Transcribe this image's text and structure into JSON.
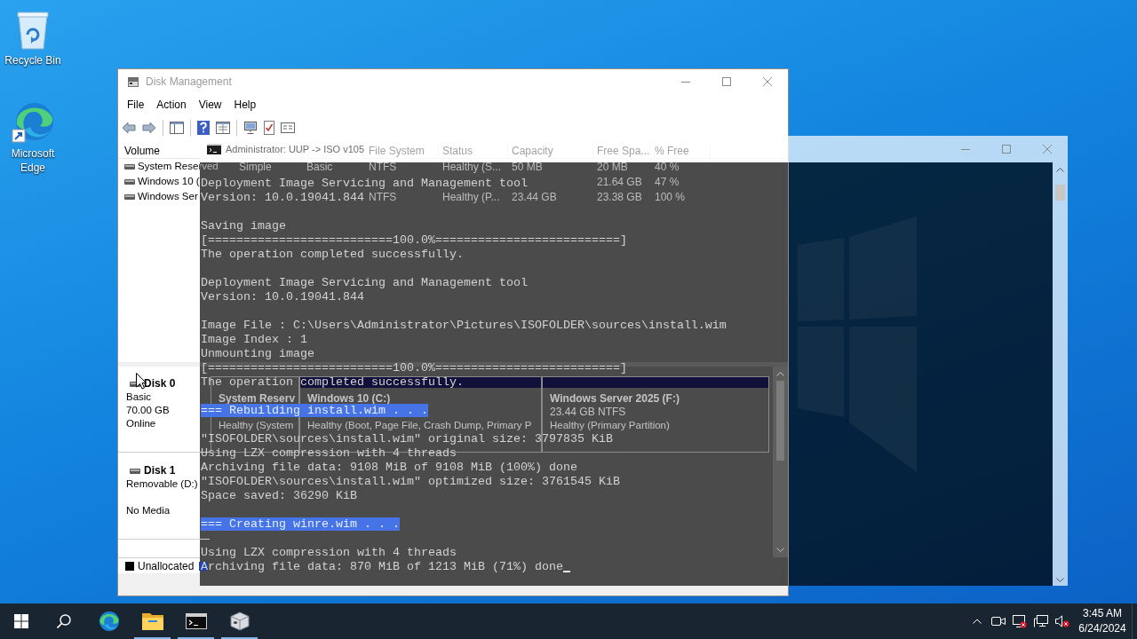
{
  "desktop": {
    "shortcuts": [
      {
        "kind": "recycle-bin",
        "label": "Recycle Bin"
      },
      {
        "kind": "edge",
        "label": "Microsoft Edge"
      }
    ]
  },
  "disk_management": {
    "window": {
      "title": "Disk Management"
    },
    "menu": [
      "File",
      "Action",
      "View",
      "Help"
    ],
    "volumes": {
      "columns": [
        "Volume",
        null,
        null,
        "File System",
        "Status",
        "Capacity",
        "Free Spa...",
        "% Free"
      ],
      "rows": [
        [
          "System Reserved",
          "Simple",
          "Basic",
          "NTFS",
          "Healthy (S...",
          "50 MB",
          "20 MB",
          "40 %"
        ],
        [
          "Windows 10 (",
          null,
          null,
          null,
          null,
          null,
          "21.64 GB",
          "47 %"
        ],
        [
          "Windows Ser",
          null,
          null,
          "NTFS",
          "Healthy (P...",
          "23.44 GB",
          "23.38 GB",
          "100 %"
        ]
      ]
    },
    "disks": [
      {
        "name": "Disk 0",
        "type": "Basic",
        "size": "70.00 GB",
        "status": "Online",
        "partitions": [
          {
            "name": "System Reserv",
            "status": "Healthy (System",
            "header_bar": false
          },
          {
            "name": "Windows 10 (C:)",
            "status": "Healthy (Boot, Page File, Crash Dump, Primary P",
            "header_bar": true
          },
          {
            "name": "Windows Server 2025 (F:)",
            "size": "23.44 GB NTFS",
            "status": "Healthy (Primary Partition)",
            "header_bar": true
          }
        ]
      },
      {
        "name": "Disk 1",
        "type": "Removable (D:)",
        "status": "No Media"
      }
    ],
    "legend": [
      {
        "label": "Unallocated",
        "color": "#000000"
      },
      {
        "color": "#2142a8"
      }
    ]
  },
  "console": {
    "title": "Administrator: UUP -> ISO v105",
    "blocks": [
      [
        {
          "text": "Deployment Image Servicing and Management tool",
          "highlighted": false
        },
        {
          "text": "Version: 10.0.19041.844",
          "highlighted": false
        }
      ],
      [
        {
          "text": "Saving image",
          "highlighted": false
        },
        {
          "text": "[==========================100.0%==========================]",
          "highlighted": false
        },
        {
          "text": "The operation completed successfully.",
          "highlighted": false
        }
      ],
      [
        {
          "text": "Deployment Image Servicing and Management tool",
          "highlighted": false
        },
        {
          "text": "Version: 10.0.19041.844",
          "highlighted": false
        }
      ],
      [
        {
          "text": "Image File : C:\\Users\\Administrator\\Pictures\\ISOFOLDER\\sources\\install.wim",
          "highlighted": false
        },
        {
          "text": "Image Index : 1",
          "highlighted": false
        },
        {
          "text": "Unmounting image",
          "highlighted": false
        },
        {
          "text": "[==========================100.0%==========================]",
          "highlighted": false
        },
        {
          "text": "The operation completed successfully.",
          "highlighted": false
        }
      ],
      [
        {
          "text": "=== Rebuilding install.wim . . .",
          "highlighted": true
        }
      ],
      [
        {
          "text": "\"ISOFOLDER\\sources\\install.wim\" original size: 3797835 KiB",
          "highlighted": false
        },
        {
          "text": "Using LZX compression with 4 threads",
          "highlighted": false
        },
        {
          "text": "Archiving file data: 9108 MiB of 9108 MiB (100%) done",
          "highlighted": false
        },
        {
          "text": "\"ISOFOLDER\\sources\\install.wim\" optimized size: 3761545 KiB",
          "highlighted": false
        },
        {
          "text": "Space saved: 36290 KiB",
          "highlighted": false
        }
      ],
      [
        {
          "text": "=== Creating winre.wim . . .",
          "highlighted": true
        }
      ],
      [
        {
          "text": "Using LZX compression with 4 threads",
          "highlighted": false
        },
        {
          "text": "Archiving file data: 870 MiB of 1213 MiB (71%) done",
          "highlighted": false
        }
      ]
    ],
    "cursor": true
  },
  "taskbar": {
    "apps": [
      {
        "kind": "edge",
        "running": false
      },
      {
        "kind": "explorer",
        "running": true
      },
      {
        "kind": "terminal",
        "running": true
      },
      {
        "kind": "disk-tool",
        "running": true
      }
    ],
    "clock": {
      "time": "3:45 AM",
      "date": "6/24/2024"
    }
  }
}
